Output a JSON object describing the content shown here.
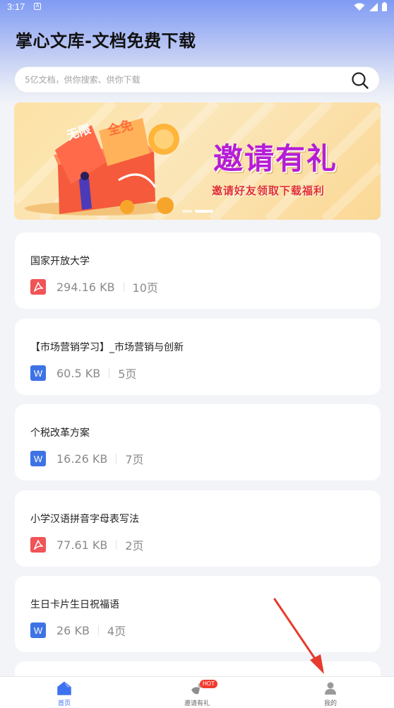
{
  "status_bar": {
    "time": "3:17",
    "notification_icon": "A"
  },
  "header": {
    "title": "掌心文库-文档免费下载"
  },
  "search": {
    "placeholder": "5亿文档，供你搜索、供你下载"
  },
  "banner": {
    "headline": "邀请有礼",
    "subtitle": "邀请好友领取下载福利",
    "box_label_1": "无限",
    "box_label_2": "全免",
    "slide_index": 1,
    "slide_count": 2
  },
  "documents": [
    {
      "title": "国家开放大学",
      "type": "pdf",
      "size": "294.16 KB",
      "pages": "10页"
    },
    {
      "title": "【市场营销学习】_市场营销与创新",
      "type": "word",
      "size": "60.5 KB",
      "pages": "5页"
    },
    {
      "title": "个税改革方案",
      "type": "word",
      "size": "16.26 KB",
      "pages": "7页"
    },
    {
      "title": "小学汉语拼音字母表写法",
      "type": "pdf",
      "size": "77.61 KB",
      "pages": "2页"
    },
    {
      "title": "生日卡片生日祝福语",
      "type": "word",
      "size": "26 KB",
      "pages": "4页"
    }
  ],
  "file_icons": {
    "pdf": "pdf-icon",
    "word": "W"
  },
  "tabbar": {
    "home": "首页",
    "invite": "邀请有礼",
    "invite_badge": "HOT",
    "mine": "我的"
  },
  "colors": {
    "accent": "#3c72ef",
    "pdf": "#f05457",
    "word": "#3d73e4",
    "arrow": "#e63b2e"
  }
}
